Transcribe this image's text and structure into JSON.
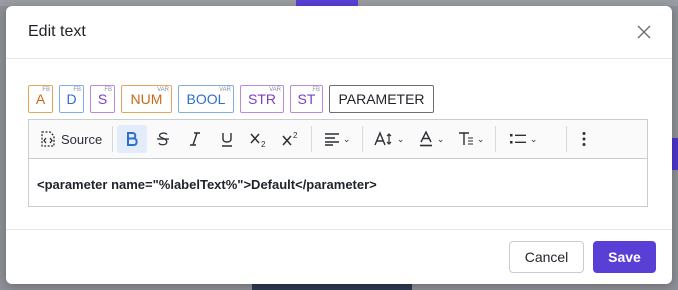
{
  "modal": {
    "title": "Edit text"
  },
  "tags": [
    {
      "label": "A",
      "sup": "FB"
    },
    {
      "label": "D",
      "sup": "FB"
    },
    {
      "label": "S",
      "sup": "FB"
    },
    {
      "label": "NUM",
      "sup": "VAR"
    },
    {
      "label": "BOOL",
      "sup": "VAR"
    },
    {
      "label": "STR",
      "sup": "VAR"
    },
    {
      "label": "ST",
      "sup": "FB"
    },
    {
      "label": "PARAMETER"
    }
  ],
  "toolbar": {
    "source_label": "Source",
    "items": [
      "source-icon",
      "bold-icon",
      "strikethrough-icon",
      "italic-icon",
      "underline-icon",
      "subscript-icon",
      "superscript-icon",
      "align-icon",
      "font-size-icon",
      "font-color-icon",
      "clear-format-icon",
      "list-icon",
      "more-icon"
    ],
    "active_color": "#e3ecfb"
  },
  "editor": {
    "content": "<parameter name=\"%labelText%\">Default</parameter>"
  },
  "footer": {
    "cancel_label": "Cancel",
    "save_label": "Save"
  },
  "colors": {
    "accent": "#5a3fd6",
    "fb_orange": "#c96a16",
    "blue": "#2f6fc9",
    "purple": "#7a3fc4"
  }
}
